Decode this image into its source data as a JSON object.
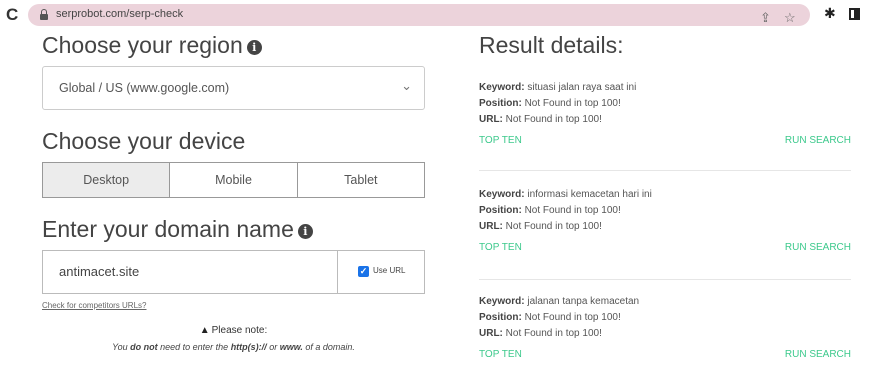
{
  "browser": {
    "url": "serprobot.com/serp-check",
    "reload_icon": "reload-icon",
    "lock_icon": "lock-icon",
    "share_icon": "share-icon",
    "bookmark_icon": "star-icon",
    "extensions_icon": "puzzle-icon",
    "sidepanel_icon": "side-panel-icon",
    "urlbar_color": "#ecd3db"
  },
  "region": {
    "heading": "Choose your region",
    "selected": "Global / US (www.google.com)"
  },
  "device": {
    "heading": "Choose your device",
    "options": [
      "Desktop",
      "Mobile",
      "Tablet"
    ],
    "selected": "Desktop"
  },
  "domain": {
    "heading": "Enter your domain name",
    "value": "antimacet.site",
    "use_url_label": "Use URL",
    "use_url_checked": true,
    "competitors_link": "Check for competitors URLs?"
  },
  "note": {
    "title": "Please note:",
    "t1": "You ",
    "b1": "do not",
    "t2": " need to enter the ",
    "b2": "http(s)://",
    "t3": " or ",
    "b3": "www.",
    "t4": " of a domain."
  },
  "results": {
    "heading": "Result details:",
    "accent_color": "#3cc98c",
    "labels": {
      "keyword": "Keyword:",
      "position": "Position:",
      "url": "URL:"
    },
    "top_ten_label": "TOP TEN",
    "run_search_label": "RUN SEARCH",
    "items": [
      {
        "keyword": "situasi jalan raya saat ini",
        "position": "Not Found in top 100!",
        "url": "Not Found in top 100!"
      },
      {
        "keyword": "informasi kemacetan hari ini",
        "position": "Not Found in top 100!",
        "url": "Not Found in top 100!"
      },
      {
        "keyword": "jalanan tanpa kemacetan",
        "position": "Not Found in top 100!",
        "url": "Not Found in top 100!"
      }
    ]
  }
}
